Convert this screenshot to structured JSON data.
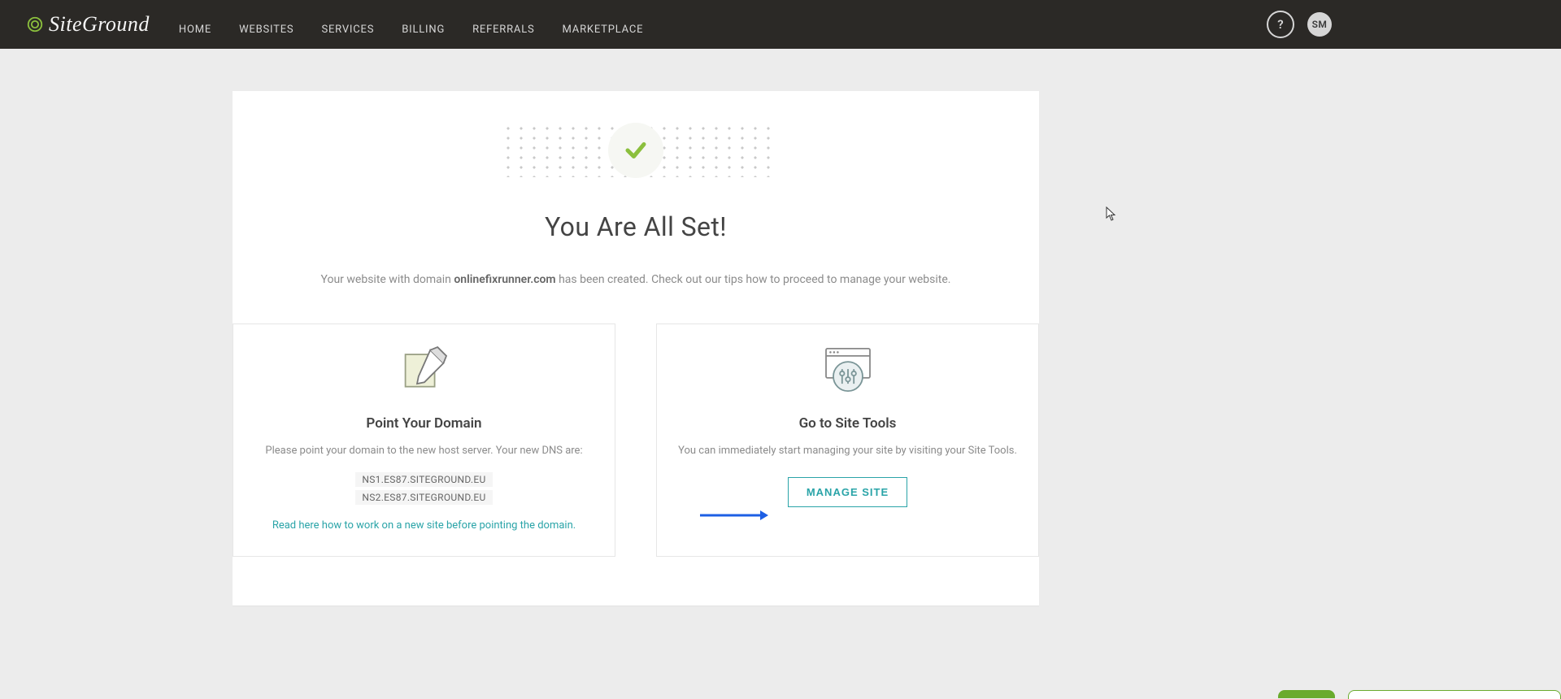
{
  "brand": {
    "name": "SiteGround"
  },
  "nav": {
    "items": [
      {
        "label": "HOME"
      },
      {
        "label": "WEBSITES"
      },
      {
        "label": "SERVICES"
      },
      {
        "label": "BILLING"
      },
      {
        "label": "REFERRALS"
      },
      {
        "label": "MARKETPLACE"
      }
    ]
  },
  "topbar": {
    "help_symbol": "?",
    "avatar_initials": "SM"
  },
  "hero": {
    "title": "You Are All Set!",
    "subtitle_pre": "Your website with domain ",
    "domain": "onlinefixrunner.com",
    "subtitle_post": " has been created. Check out our tips how to proceed to manage your website."
  },
  "panels": {
    "left": {
      "title": "Point Your Domain",
      "desc": "Please point your domain to the new host server. Your new DNS are:",
      "dns1": "NS1.ES87.SITEGROUND.EU",
      "dns2": "NS2.ES87.SITEGROUND.EU",
      "hint_link": "Read here",
      "hint_rest": " how to work on a new site before pointing the domain."
    },
    "right": {
      "title": "Go to Site Tools",
      "desc": "You can immediately start managing your site by visiting your Site Tools.",
      "button": "MANAGE SITE"
    }
  }
}
